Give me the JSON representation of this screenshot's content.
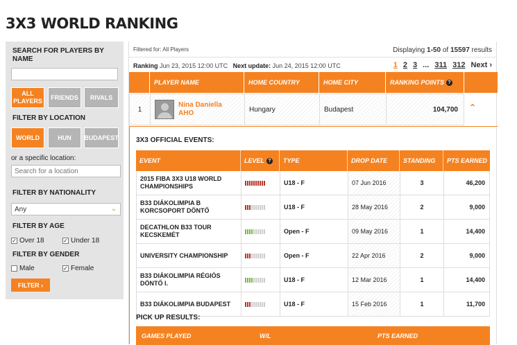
{
  "page_title": "3X3 WORLD RANKING",
  "sidebar": {
    "search_label": "SEARCH FOR PLAYERS BY NAME",
    "search_value": "",
    "type_buttons": [
      "ALL PLAYERS",
      "FRIENDS",
      "RIVALS"
    ],
    "filter_location_label": "FILTER BY LOCATION",
    "location_buttons": [
      "WORLD",
      "HUN",
      "BUDAPEST"
    ],
    "specific_location_label": "or a specific location:",
    "location_placeholder": "Search for a location",
    "filter_nationality_label": "FILTER BY NATIONALITY",
    "nationality_value": "Any",
    "filter_age_label": "FILTER BY AGE",
    "age_options": [
      {
        "label": "Over 18",
        "checked": true
      },
      {
        "label": "Under 18",
        "checked": true
      }
    ],
    "filter_gender_label": "FILTER BY GENDER",
    "gender_options": [
      {
        "label": "Male",
        "checked": false
      },
      {
        "label": "Female",
        "checked": true
      }
    ],
    "filter_button": "FILTER ›"
  },
  "main": {
    "filtered_for": "Filtered for: All Players",
    "displaying": {
      "prefix": "Displaying",
      "range": "1-50",
      "of": "of",
      "total": "15597",
      "suffix": "results"
    },
    "ranking_label": "Ranking",
    "ranking_date": "Jun 23, 2015 12:00 UTC",
    "next_update_label": "Next update:",
    "next_update_date": "Jun 24, 2015 12:00 UTC",
    "pager": [
      "1",
      "2",
      "3",
      "...",
      "311",
      "312",
      "Next ›"
    ],
    "player_headers": [
      "PLAYER NAME",
      "HOME COUNTRY",
      "HOME CITY",
      "RANKING POINTS"
    ],
    "player": {
      "rank": "1",
      "first_name": "Nina Daniella",
      "last_name": "AHO",
      "country": "Hungary",
      "city": "Budapest",
      "points": "104,700"
    },
    "collapse_icon": "chevron-up-icon",
    "events_title": "3X3 OFFICIAL EVENTS:",
    "event_headers": [
      "EVENT",
      "LEVEL",
      "TYPE",
      "DROP DATE",
      "STANDING",
      "PTS EARNED"
    ],
    "events": [
      {
        "event": "2015 FIBA 3X3 U18 WORLD CHAMPIONSHIPS",
        "level": 10,
        "level_color": "red",
        "type": "U18 - F",
        "drop_date": "07 Jun 2016",
        "standing": "3",
        "pts": "46,200"
      },
      {
        "event": "B33 DIÁKOLIMPIA B KORCSOPORT DÖNTŐ",
        "level": 3,
        "level_color": "red",
        "type": "U18 - F",
        "drop_date": "28 May 2016",
        "standing": "2",
        "pts": "9,000"
      },
      {
        "event": "DECATHLON B33 TOUR KECSKEMÉT",
        "level": 4,
        "level_color": "green",
        "type": "Open - F",
        "drop_date": "09 May 2016",
        "standing": "1",
        "pts": "14,400"
      },
      {
        "event": "UNIVERSITY CHAMPIONSHIP",
        "level": 3,
        "level_color": "red",
        "type": "Open - F",
        "drop_date": "22 Apr 2016",
        "standing": "2",
        "pts": "9,000"
      },
      {
        "event": "B33 DIÁKOLIMPIA RÉGIÓS DÖNTŐ I.",
        "level": 4,
        "level_color": "green",
        "type": "U18 - F",
        "drop_date": "12 Mar 2016",
        "standing": "1",
        "pts": "14,400"
      },
      {
        "event": "B33 DIÁKOLIMPIA BUDAPEST",
        "level": 3,
        "level_color": "red",
        "type": "U18 - F",
        "drop_date": "15 Feb 2016",
        "standing": "1",
        "pts": "11,700"
      }
    ],
    "pickup_title": "PICK UP RESULTS:",
    "pickup_headers": [
      "GAMES PLAYED",
      "W/L",
      "PTS EARNED"
    ]
  },
  "colors": {
    "accent": "#f58220",
    "sidebar_bg": "#e4e4e4",
    "level_red": "#b5352b",
    "level_green": "#7ab648"
  }
}
